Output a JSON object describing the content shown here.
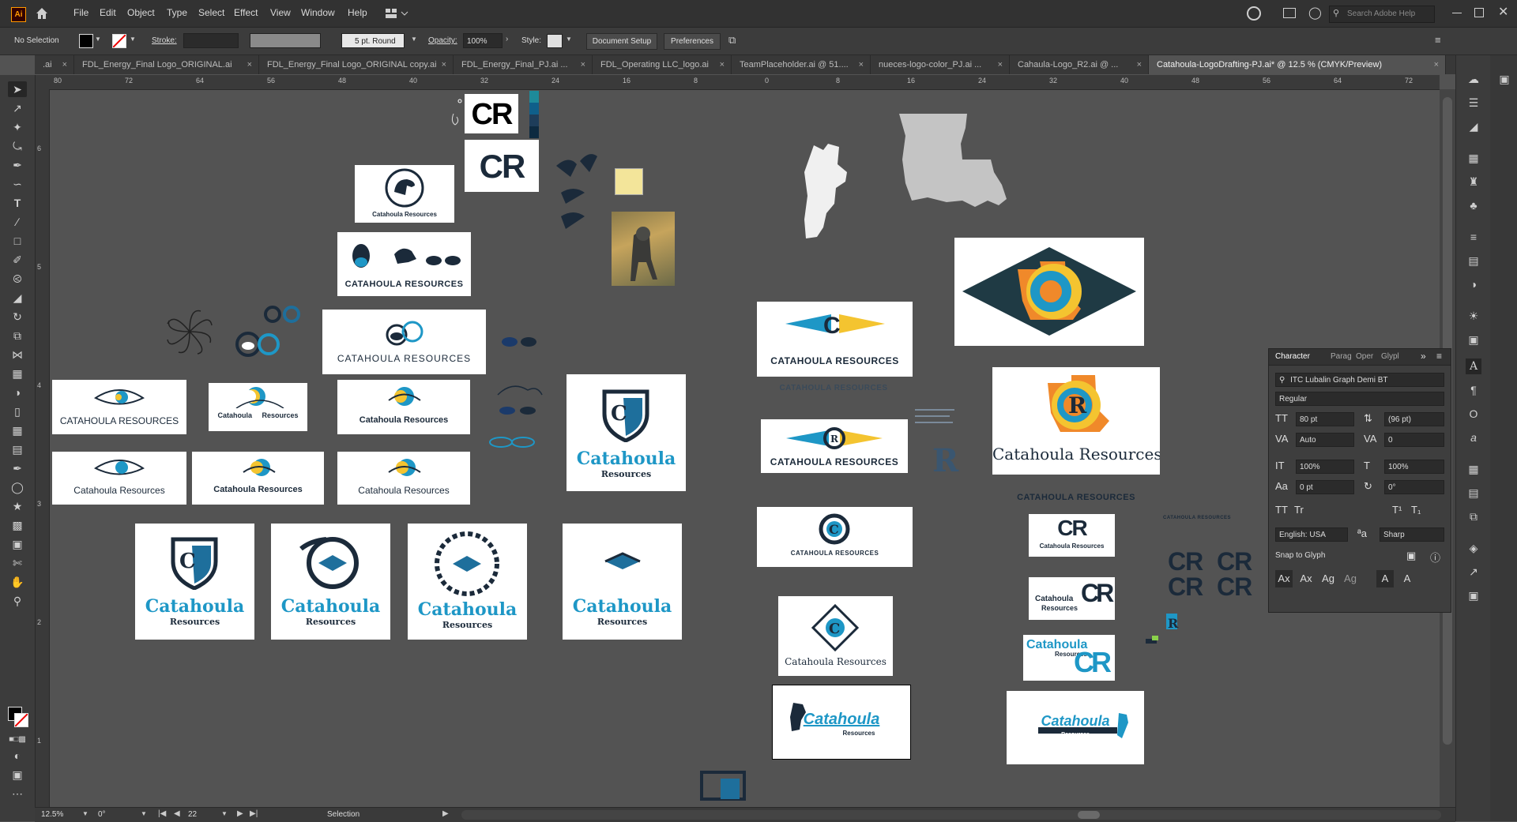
{
  "menu": [
    "File",
    "Edit",
    "Object",
    "Type",
    "Select",
    "Effect",
    "View",
    "Window",
    "Help"
  ],
  "app_logo": "Ai",
  "search_placeholder": "Search Adobe Help",
  "control": {
    "selection": "No Selection",
    "stroke_label": "Stroke:",
    "brush": "5 pt. Round",
    "opacity_label": "Opacity:",
    "opacity": "100%",
    "style_label": "Style:",
    "document_setup": "Document Setup",
    "preferences": "Preferences"
  },
  "tabs": [
    {
      "label": ".ai"
    },
    {
      "label": "FDL_Energy_Final Logo_ORIGINAL.ai"
    },
    {
      "label": "FDL_Energy_Final Logo_ORIGINAL copy.ai"
    },
    {
      "label": "FDL_Energy_Final_PJ.ai ..."
    },
    {
      "label": "FDL_Operating LLC_logo.ai"
    },
    {
      "label": "TeamPlaceholder.ai @ 51...."
    },
    {
      "label": "nueces-logo-color_PJ.ai ..."
    },
    {
      "label": "Cahaula-Logo_R2.ai @ ..."
    },
    {
      "label": "Catahoula-LogoDrafting-PJ.ai* @ 12.5 % (CMYK/Preview)"
    }
  ],
  "ruler_h": [
    "80",
    "72",
    "64",
    "56",
    "48",
    "40",
    "32",
    "24",
    "16",
    "8",
    "0",
    "8",
    "16",
    "24",
    "32",
    "40",
    "48",
    "56",
    "64",
    "72"
  ],
  "ruler_v": [
    "6",
    "5",
    "4",
    "3",
    "2",
    "1"
  ],
  "logos": {
    "cr": "CR",
    "r": "R",
    "company_caps": "CATAHOULA RESOURCES",
    "company_title": "Catahoula Resources",
    "catahoula": "Catahoula",
    "resources": "Resources"
  },
  "status": {
    "zoom": "12.5%",
    "rotation": "0°",
    "artboard": "22",
    "tool": "Selection"
  },
  "character": {
    "title": "Character",
    "tab2": "Parag",
    "tab3": "Oper",
    "tab4": "Glypl",
    "font": "ITC Lubalin Graph Demi BT",
    "style": "Regular",
    "size": "80 pt",
    "leading": "(96 pt)",
    "kerning": "Auto",
    "tracking": "0",
    "vscale": "100%",
    "hscale": "100%",
    "baseline": "0 pt",
    "rotate": "0°",
    "language": "English: USA",
    "aa": "Sharp",
    "snap": "Snap to Glyph"
  },
  "colors": {
    "navy": "#1b2a3a",
    "blue": "#1e97c6",
    "yellow": "#f4c430",
    "orange": "#f0892a"
  }
}
